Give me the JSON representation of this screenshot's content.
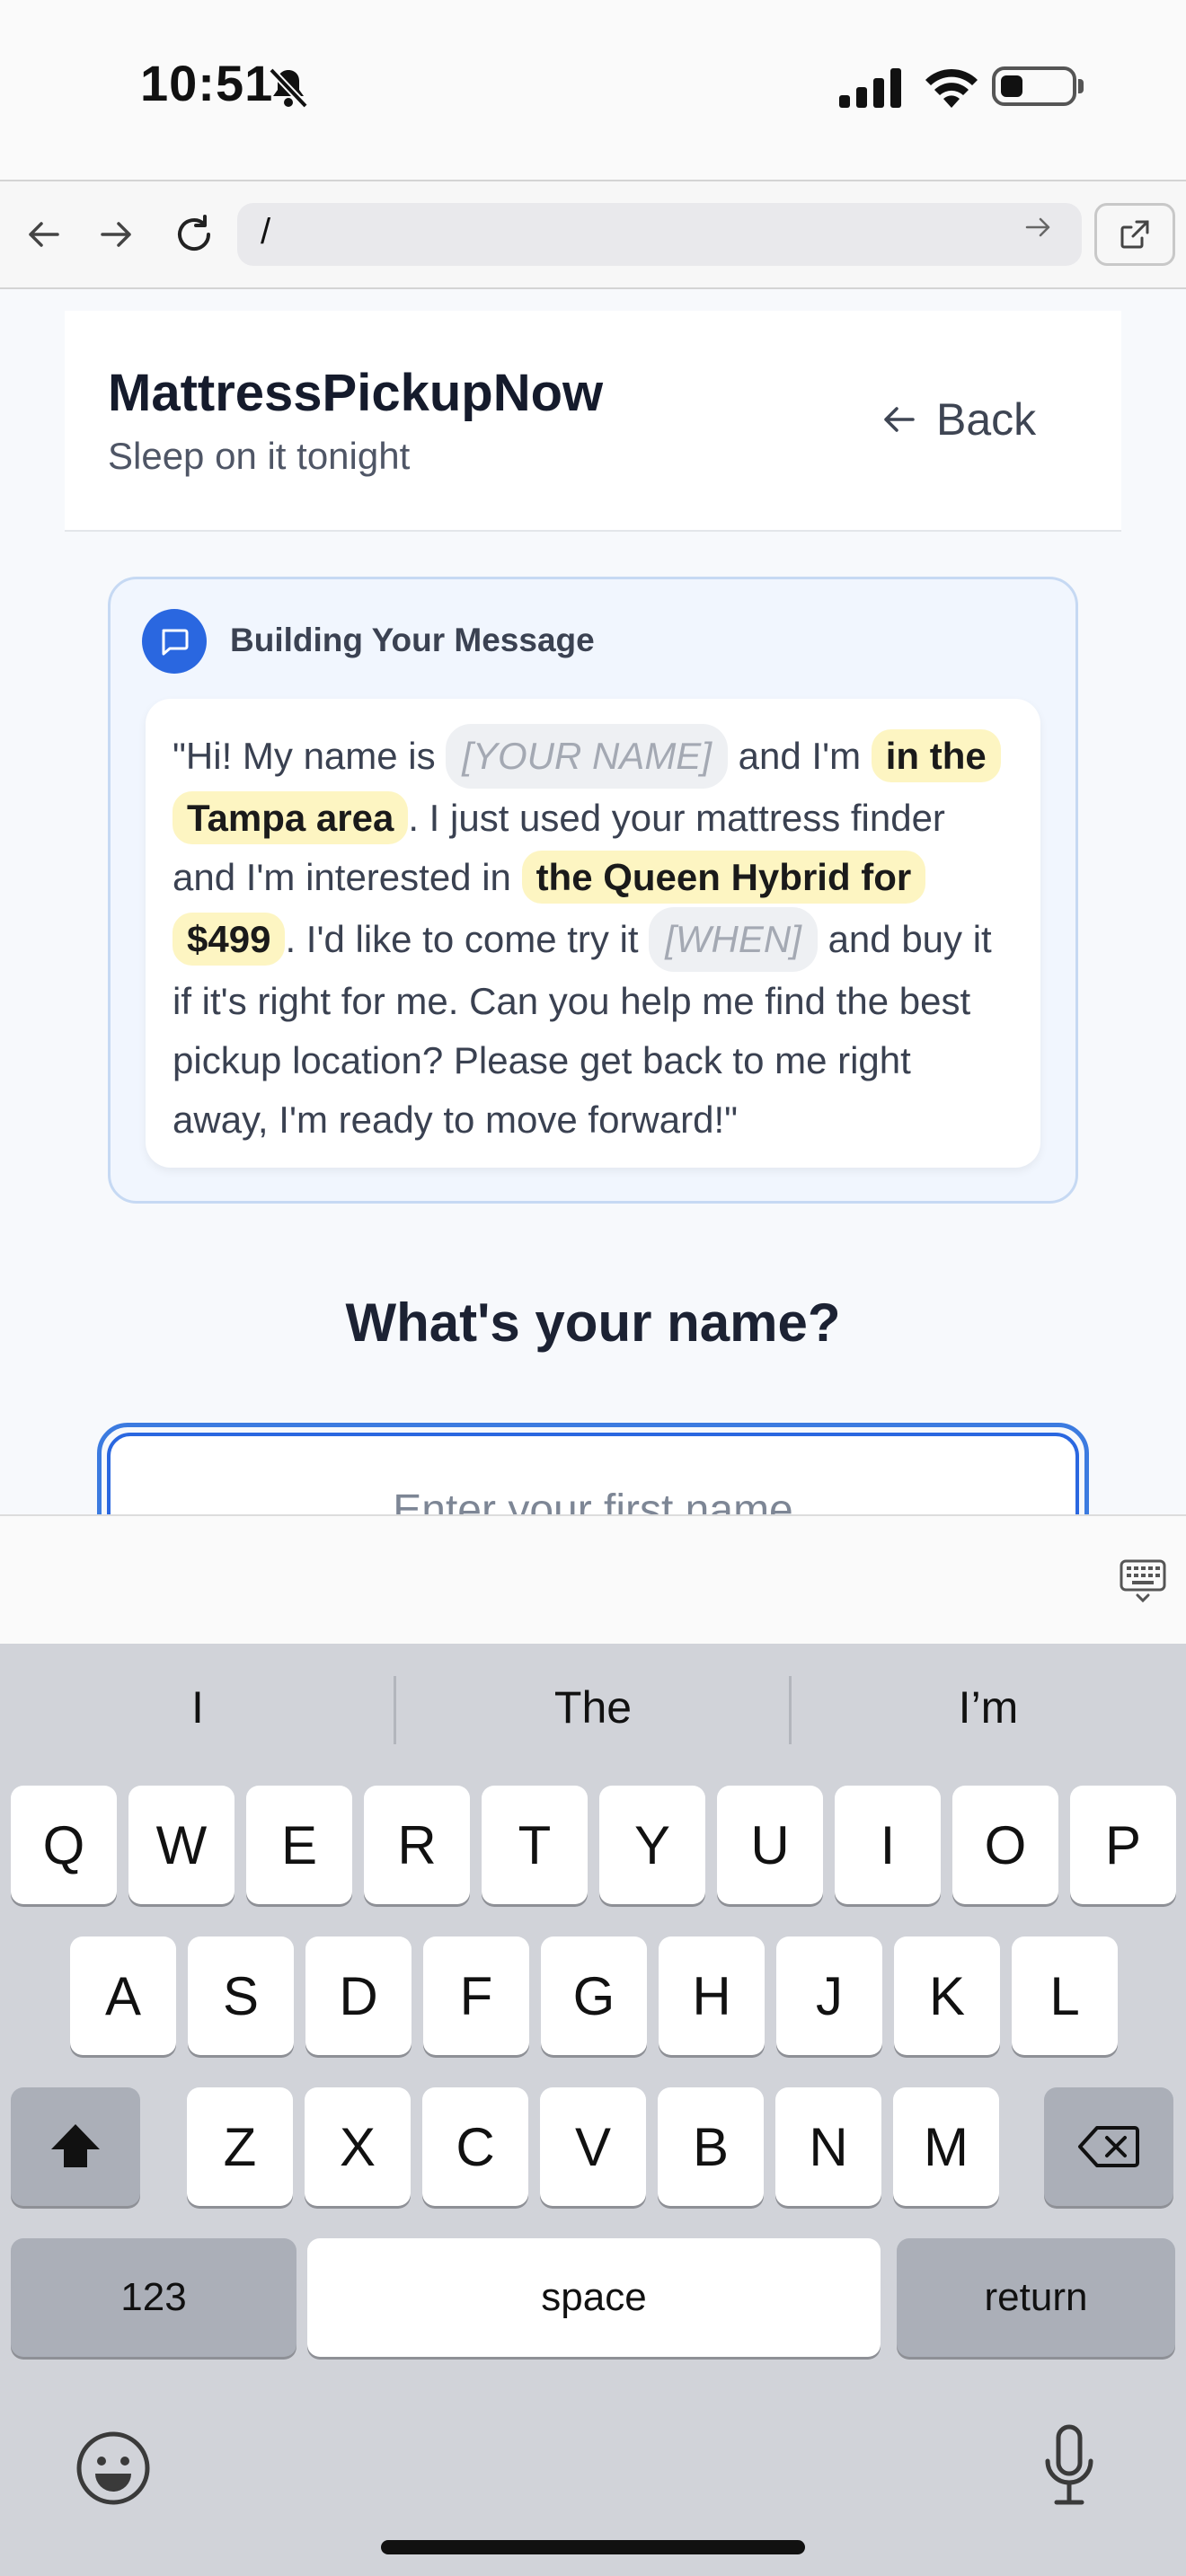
{
  "status_bar": {
    "time": "10:51"
  },
  "browser": {
    "url": "/"
  },
  "header": {
    "brand": "MattressPickupNow",
    "tagline": "Sleep on it tonight",
    "back_label": "Back"
  },
  "message_card": {
    "title": "Building Your Message",
    "segments": {
      "s1": "\"Hi! My name is ",
      "name_placeholder": "[YOUR NAME]",
      "s2": " and I'm ",
      "location": "in the Tampa area",
      "s3": ". I just used your mattress finder and I'm interested in ",
      "product": "the Queen Hybrid for $499",
      "s4": ". I'd like to come try it ",
      "when_placeholder": "[WHEN]",
      "s5": " and buy it if it's right for me. Can you help me find the best pickup location? Please get back to me right away, I'm ready to move forward!\""
    }
  },
  "form": {
    "question": "What's your name?",
    "name_placeholder": "Enter your first name"
  },
  "keyboard": {
    "suggestions": [
      "I",
      "The",
      "I’m"
    ],
    "row1": [
      "Q",
      "W",
      "E",
      "R",
      "T",
      "Y",
      "U",
      "I",
      "O",
      "P"
    ],
    "row2": [
      "A",
      "S",
      "D",
      "F",
      "G",
      "H",
      "J",
      "K",
      "L"
    ],
    "row3": [
      "Z",
      "X",
      "C",
      "V",
      "B",
      "N",
      "M"
    ],
    "numbers_label": "123",
    "space_label": "space",
    "return_label": "return"
  }
}
